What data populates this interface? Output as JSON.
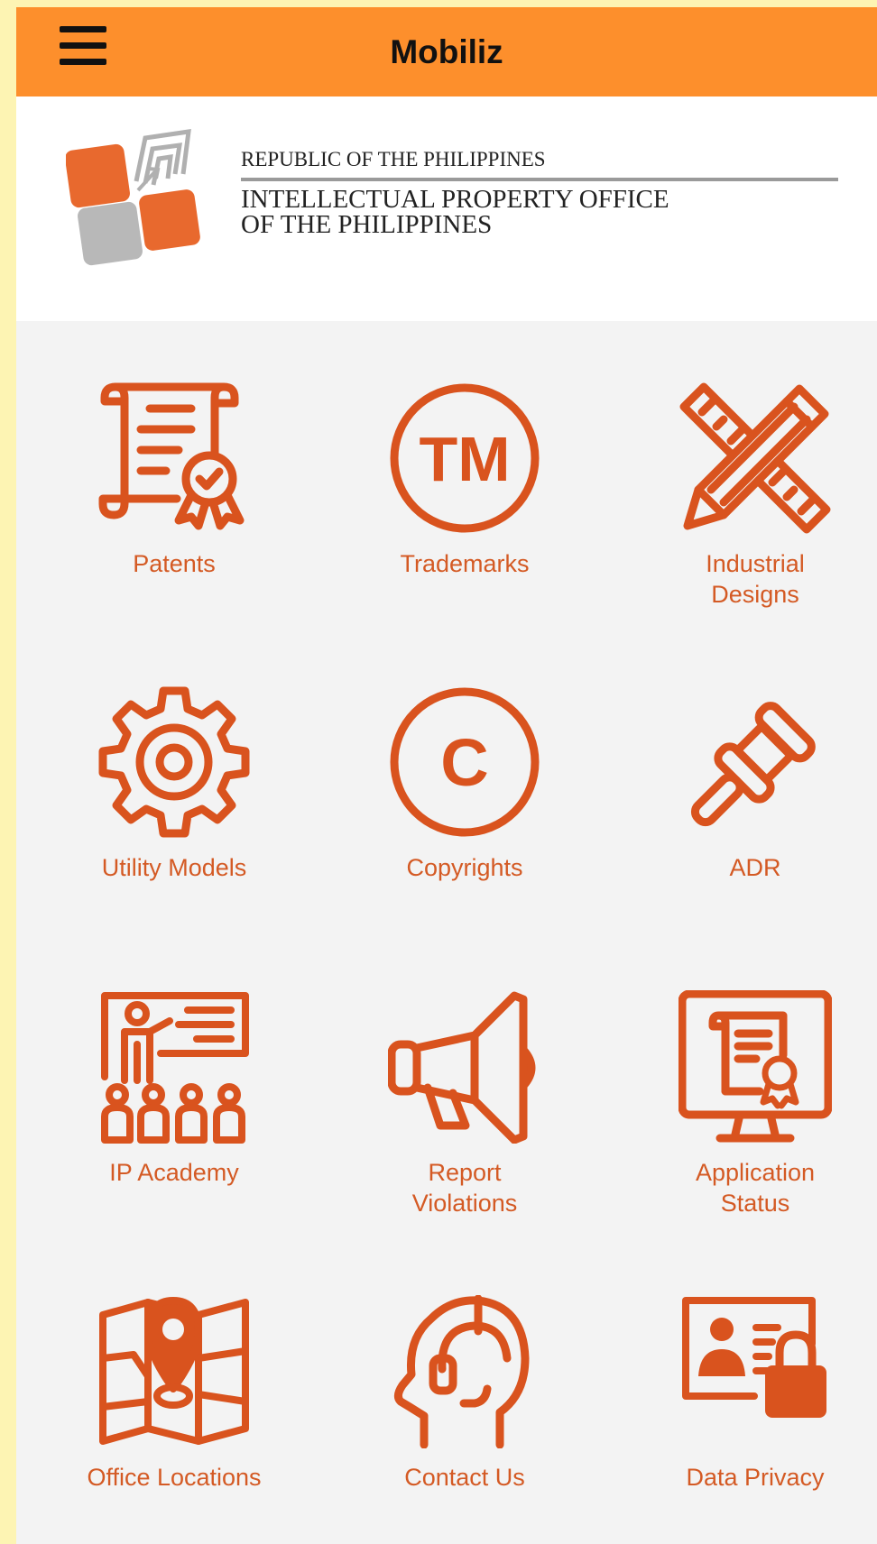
{
  "app": {
    "title": "Mobiliz"
  },
  "header": {
    "line1": "REPUBLIC OF THE PHILIPPINES",
    "line2": "INTELLECTUAL PROPERTY OFFICE",
    "line3": "OF THE PHILIPPINES"
  },
  "colors": {
    "accent": "#d9531e",
    "topbar": "#fd8f2c",
    "logo_orange": "#e8692e",
    "logo_gray": "#b8b8b8"
  },
  "menu": {
    "items": [
      {
        "label": "Patents",
        "icon": "patent-certificate-icon"
      },
      {
        "label": "Trademarks",
        "icon": "trademark-icon"
      },
      {
        "label": "Industrial\nDesigns",
        "icon": "ruler-pencil-icon"
      },
      {
        "label": "Utility Models",
        "icon": "gear-icon"
      },
      {
        "label": "Copyrights",
        "icon": "copyright-icon"
      },
      {
        "label": "ADR",
        "icon": "gavel-icon"
      },
      {
        "label": "IP Academy",
        "icon": "classroom-icon"
      },
      {
        "label": "Report\nViolations",
        "icon": "megaphone-icon"
      },
      {
        "label": "Application\nStatus",
        "icon": "monitor-certificate-icon"
      },
      {
        "label": "Office Locations",
        "icon": "map-pin-icon"
      },
      {
        "label": "Contact Us",
        "icon": "headset-icon"
      },
      {
        "label": "Data Privacy",
        "icon": "id-card-lock-icon"
      }
    ]
  }
}
